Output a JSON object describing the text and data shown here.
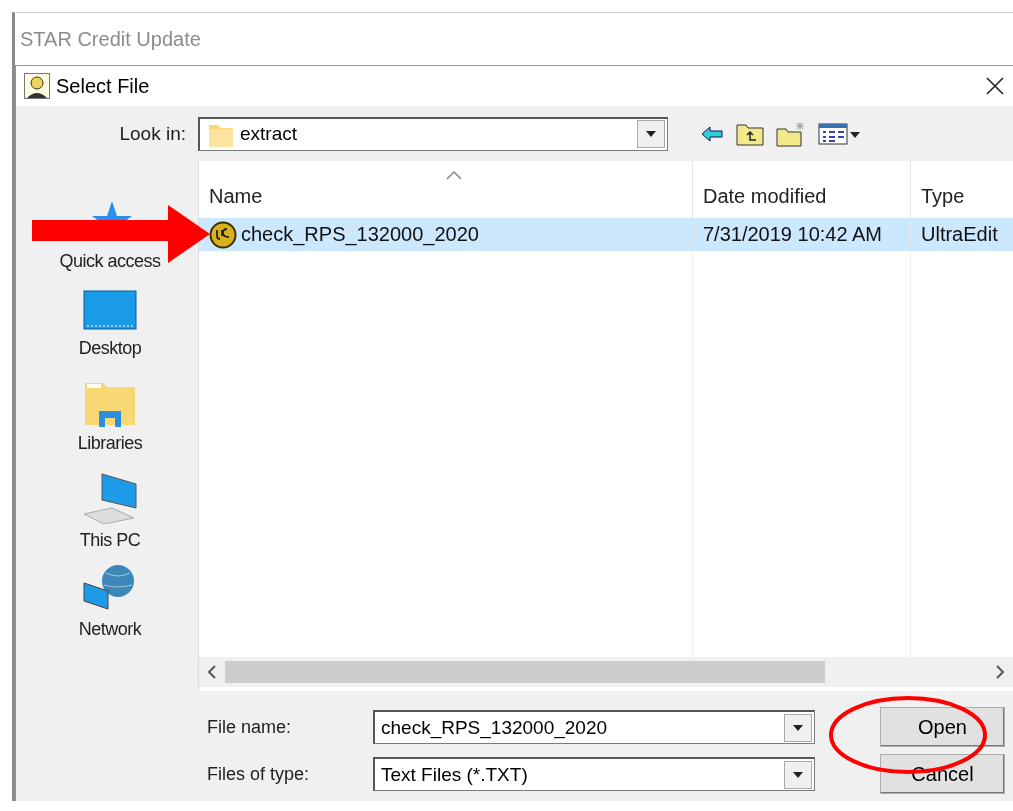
{
  "outer_window": {
    "title": "STAR Credit Update"
  },
  "dialog": {
    "title": "Select File"
  },
  "look_in": {
    "label": "Look in:",
    "value": "extract"
  },
  "places": [
    {
      "kind": "quick_access",
      "label": "Quick access"
    },
    {
      "kind": "desktop",
      "label": "Desktop"
    },
    {
      "kind": "libraries",
      "label": "Libraries"
    },
    {
      "kind": "this_pc",
      "label": "This PC"
    },
    {
      "kind": "network",
      "label": "Network"
    }
  ],
  "file_list": {
    "columns": [
      {
        "label": "Name",
        "sorted": true
      },
      {
        "label": "Date modified",
        "sorted": false
      },
      {
        "label": "Type",
        "sorted": false
      }
    ],
    "rows": [
      {
        "name": "check_RPS_132000_2020",
        "date_modified": "7/31/2019 10:42 AM",
        "type": "UltraEdit",
        "selected": true,
        "annotated": true
      }
    ]
  },
  "file_name": {
    "label": "File name:",
    "value": "check_RPS_132000_2020"
  },
  "file_type": {
    "label": "Files of type:",
    "value": "Text Files (*.TXT)"
  },
  "buttons": [
    {
      "label": "Open",
      "annotated": true
    },
    {
      "label": "Cancel",
      "annotated": false
    }
  ]
}
